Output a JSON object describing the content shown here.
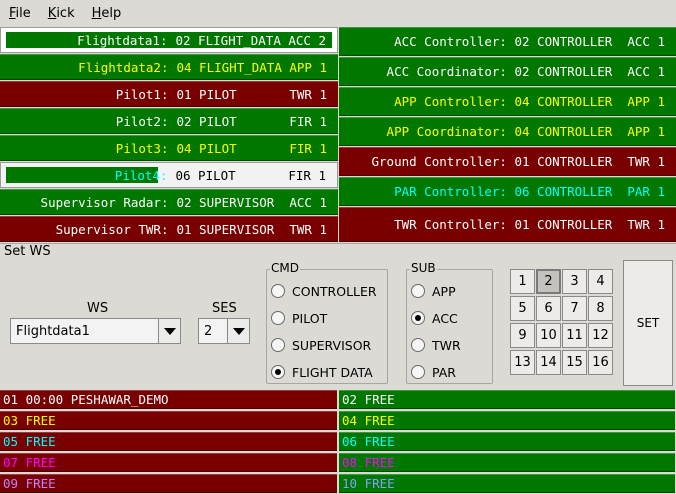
{
  "menu": [
    {
      "label": "File",
      "u": "F",
      "rest": "ile"
    },
    {
      "label": "Kick",
      "u": "K",
      "rest": "ick"
    },
    {
      "label": "Help",
      "u": "H",
      "rest": "elp"
    }
  ],
  "left_rows": [
    {
      "name": "Flightdata1:",
      "value": "02 FLIGHT_DATA ACC 2",
      "state": "selected",
      "color": "#ffffff"
    },
    {
      "name": "Flightdata2:",
      "value": "04 FLIGHT_DATA APP 1",
      "state": "green",
      "color": "#ffff00"
    },
    {
      "name": "Pilot1:",
      "value": "01 PILOT       TWR 1",
      "state": "red",
      "color": "#ffffff"
    },
    {
      "name": "Pilot2:",
      "value": "02 PILOT       FIR 1",
      "state": "green",
      "color": "#ffffff"
    },
    {
      "name": "Pilot3:",
      "value": "04 PILOT       FIR 1",
      "state": "green",
      "color": "#ffff00"
    },
    {
      "name": "Pilot4:",
      "value": "06 PILOT       FIR 1",
      "state": "highlight",
      "color": "#00ffff"
    },
    {
      "name": "Supervisor Radar:",
      "value": "02 SUPERVISOR  ACC 1",
      "state": "green",
      "color": "#ffffff"
    },
    {
      "name": "Supervisor TWR:",
      "value": "01 SUPERVISOR  TWR 1",
      "state": "red",
      "color": "#ffffff"
    }
  ],
  "right_rows": [
    {
      "text": "ACC Controller: 02 CONTROLLER  ACC 1",
      "state": "green",
      "color": "#ffffff"
    },
    {
      "text": "ACC Coordinator: 02 CONTROLLER  ACC 1",
      "state": "green",
      "color": "#ffffff"
    },
    {
      "text": "APP Controller: 04 CONTROLLER  APP 1",
      "state": "green",
      "color": "#ffff00"
    },
    {
      "text": "APP Coordinator: 04 CONTROLLER  APP 1",
      "state": "green",
      "color": "#ffff00"
    },
    {
      "text": "Ground Controller: 01 CONTROLLER  TWR 1",
      "state": "red",
      "color": "#ffffff"
    },
    {
      "text": "PAR Controller: 06 CONTROLLER  PAR 1",
      "state": "green",
      "color": "#00ffff"
    },
    {
      "text": "TWR Controller: 01 CONTROLLER  TWR 1",
      "state": "red",
      "color": "#ffffff"
    }
  ],
  "setws": {
    "title": "Set WS",
    "ws_label": "WS",
    "ws_value": "Flightdata1",
    "ses_label": "SES",
    "ses_value": "2",
    "cmd_title": "CMD",
    "cmd_options": [
      {
        "label": "CONTROLLER",
        "checked": false
      },
      {
        "label": "PILOT",
        "checked": false
      },
      {
        "label": "SUPERVISOR",
        "checked": false
      },
      {
        "label": "FLIGHT DATA",
        "checked": true
      }
    ],
    "sub_title": "SUB",
    "sub_options": [
      {
        "label": "APP",
        "checked": false
      },
      {
        "label": "ACC",
        "checked": true
      },
      {
        "label": "TWR",
        "checked": false
      },
      {
        "label": "PAR",
        "checked": false
      }
    ],
    "grid": [
      "1",
      "2",
      "3",
      "4",
      "5",
      "6",
      "7",
      "8",
      "9",
      "10",
      "11",
      "12",
      "13",
      "14",
      "15",
      "16"
    ],
    "grid_selected": "2",
    "set_label": "SET"
  },
  "slots": [
    {
      "text": "01 00:00 PESHAWAR_DEMO",
      "state": "red",
      "color": "#ffffff"
    },
    {
      "text": "02 FREE",
      "state": "green",
      "color": "#ffffff"
    },
    {
      "text": "03 FREE",
      "state": "red",
      "color": "#ffff00"
    },
    {
      "text": "04 FREE",
      "state": "green",
      "color": "#ffff00"
    },
    {
      "text": "05 FREE",
      "state": "red",
      "color": "#00ffff"
    },
    {
      "text": "06 FREE",
      "state": "green",
      "color": "#00ffff"
    },
    {
      "text": "07 FREE",
      "state": "red",
      "color": "#ff00ff"
    },
    {
      "text": "08 FREE",
      "state": "green",
      "color": "#ff00ff"
    },
    {
      "text": "09 FREE",
      "state": "red",
      "color": "#c080ff"
    },
    {
      "text": "10 FREE",
      "state": "green",
      "color": "#80a0ff"
    }
  ]
}
